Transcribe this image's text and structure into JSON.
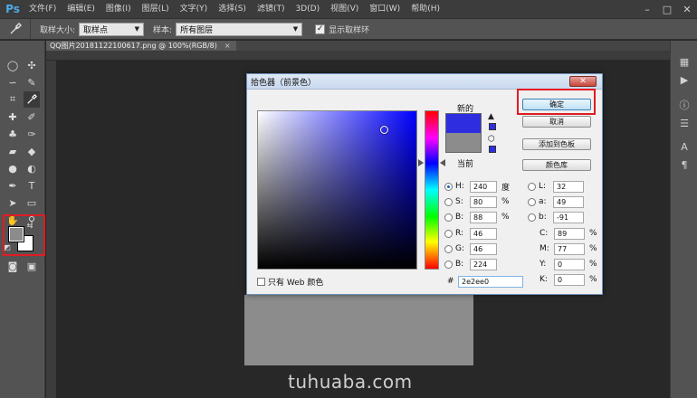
{
  "app": {
    "logo": "Ps",
    "menu": [
      "文件(F)",
      "编辑(E)",
      "图像(I)",
      "图层(L)",
      "文字(Y)",
      "选择(S)",
      "滤镜(T)",
      "3D(D)",
      "视图(V)",
      "窗口(W)",
      "帮助(H)"
    ],
    "window_controls": [
      "–",
      "□",
      "✕"
    ]
  },
  "options_bar": {
    "tool_icon": "eyedropper-icon",
    "sample_size_label": "取样大小:",
    "sample_size_value": "取样点",
    "sample_label": "样本:",
    "sample_value": "所有图层",
    "show_ring_label": "显示取样环",
    "show_ring_checked": true
  },
  "document": {
    "tab_title": "QQ图片20181122100617.png @ 100%(RGB/8)",
    "tab_close": "×",
    "canvas_color": "#8c8c8c"
  },
  "watermark": "tuhuaba.com",
  "dialog": {
    "title": "拾色器（前景色）",
    "close": "✕",
    "new_label": "新的",
    "current_label": "当前",
    "new_color": "#2e2ee0",
    "current_color": "#8c8c8c",
    "buttons": {
      "ok": "确定",
      "cancel": "取消",
      "add_to_swatches": "添加到色板",
      "color_libraries": "颜色库"
    },
    "hsb": [
      {
        "label": "H:",
        "value": "240",
        "unit": "度",
        "selected": true
      },
      {
        "label": "S:",
        "value": "80",
        "unit": "%",
        "selected": false
      },
      {
        "label": "B:",
        "value": "88",
        "unit": "%",
        "selected": false
      }
    ],
    "rgb": [
      {
        "label": "R:",
        "value": "46"
      },
      {
        "label": "G:",
        "value": "46"
      },
      {
        "label": "B:",
        "value": "224"
      }
    ],
    "lab": [
      {
        "label": "L:",
        "value": "32"
      },
      {
        "label": "a:",
        "value": "49"
      },
      {
        "label": "b:",
        "value": "-91"
      }
    ],
    "cmyk": [
      {
        "label": "C:",
        "value": "89",
        "unit": "%"
      },
      {
        "label": "M:",
        "value": "77",
        "unit": "%"
      },
      {
        "label": "Y:",
        "value": "0",
        "unit": "%"
      },
      {
        "label": "K:",
        "value": "0",
        "unit": "%"
      }
    ],
    "hex_label": "#",
    "hex_value": "2e2ee0",
    "web_only_label": "只有 Web 颜色",
    "hue_degrees": 240,
    "saturation_pct": 80,
    "brightness_pct": 88
  },
  "colors": {
    "highlight": "#e01b24",
    "foreground": "#8c8c8c",
    "background": "#ffffff"
  }
}
